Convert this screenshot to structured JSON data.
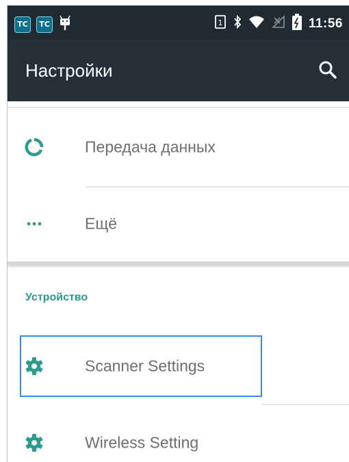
{
  "status_bar": {
    "left_icons": [
      "TC",
      "TC"
    ],
    "icons": [
      "android-debug-icon",
      "sim-icon",
      "bluetooth-icon",
      "wifi-icon",
      "no-signal-icon",
      "battery-icon"
    ],
    "sim_slot": "1",
    "time": "11:56"
  },
  "app_bar": {
    "title": "Настройки",
    "search_icon": "search-icon"
  },
  "list": {
    "items": [
      {
        "label": "Передача данных",
        "icon": "data-usage-icon"
      },
      {
        "label": "Ещё",
        "icon": "more-icon"
      }
    ],
    "section_header": "Устройство",
    "device_items": [
      {
        "label": "Scanner Settings",
        "icon": "gear-icon"
      },
      {
        "label": "Wireless Setting",
        "icon": "gear-icon"
      }
    ]
  },
  "colors": {
    "status_bar_bg": "#1f2a33",
    "app_bar_bg": "#253038",
    "accent": "#2a9c8c",
    "highlight": "#3d89df"
  }
}
